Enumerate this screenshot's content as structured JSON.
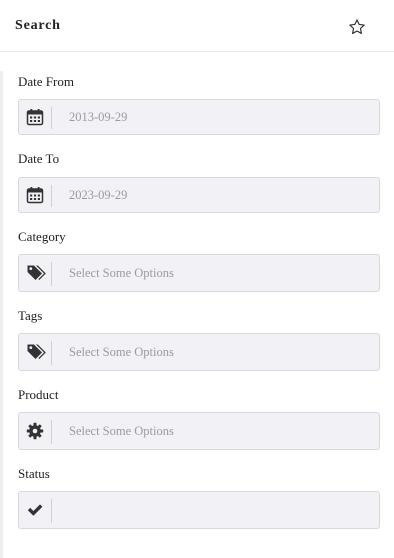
{
  "header": {
    "title": "Search"
  },
  "fields": [
    {
      "label": "Date From",
      "value": "2013-09-29",
      "icon": "calendar-icon"
    },
    {
      "label": "Date To",
      "value": "2023-09-29",
      "icon": "calendar-icon"
    },
    {
      "label": "Category",
      "placeholder": "Select Some Options",
      "icon": "tags-icon"
    },
    {
      "label": "Tags",
      "placeholder": "Select Some Options",
      "icon": "tags-icon"
    },
    {
      "label": "Product",
      "placeholder": "Select Some Options",
      "icon": "gear-icon"
    },
    {
      "label": "Status",
      "value": "",
      "icon": "check-icon"
    }
  ],
  "colors": {
    "field_background": "#f2f1f6",
    "field_border": "#d9d8de",
    "placeholder_text": "#9a9aa2",
    "icon": "#333333"
  }
}
